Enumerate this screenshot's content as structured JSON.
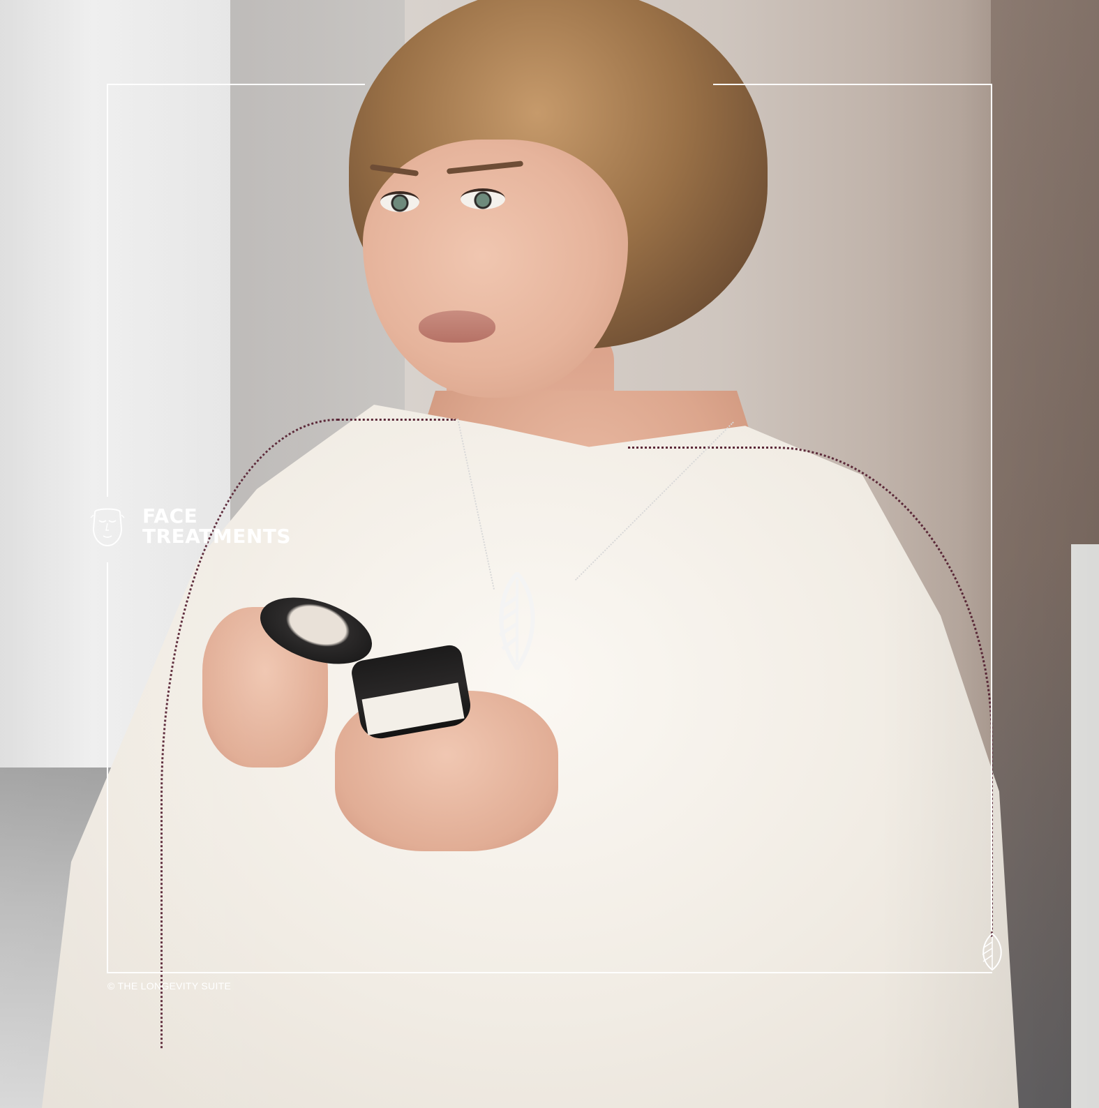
{
  "section": {
    "title_line1": "FACE",
    "title_line2": "TREATMENTS",
    "icon": "face-icon"
  },
  "footer": {
    "copyright": "© THE LONGEVITY SUITE",
    "logo_icon": "leaf-logo-icon"
  },
  "colors": {
    "overlay_text": "#ffffff",
    "robe_stitch": "#5b2838",
    "robe": "#f3eee6"
  }
}
